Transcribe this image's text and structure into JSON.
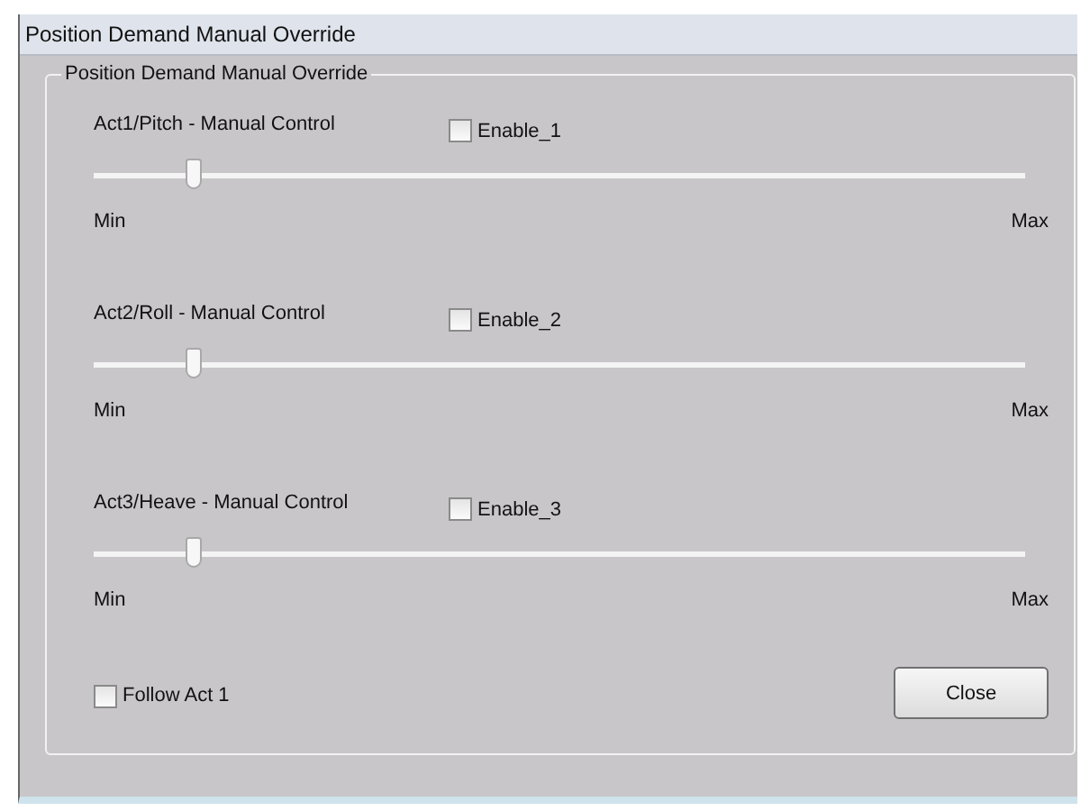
{
  "window": {
    "title": "Position Demand Manual Override"
  },
  "group": {
    "title": "Position Demand Manual Override"
  },
  "controls": [
    {
      "label": "Act1/Pitch - Manual Control",
      "enable": {
        "label": "Enable_1",
        "checked": false
      },
      "level": 0.107,
      "min": "Min",
      "max": "Max"
    },
    {
      "label": "Act2/Roll - Manual Control",
      "enable": {
        "label": "Enable_2",
        "checked": false
      },
      "level": 0.107,
      "min": "Min",
      "max": "Max"
    },
    {
      "label": "Act3/Heave - Manual Control",
      "enable": {
        "label": "Enable_3",
        "checked": false
      },
      "level": 0.107,
      "min": "Min",
      "max": "Max"
    }
  ],
  "follow": {
    "label": "Follow Act 1",
    "checked": false
  },
  "buttons": [
    "Close"
  ]
}
